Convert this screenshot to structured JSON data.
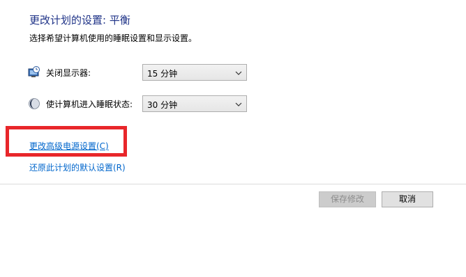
{
  "header": {
    "title": "更改计划的设置: 平衡",
    "subtitle": "选择希望计算机使用的睡眠设置和显示设置。"
  },
  "settings": {
    "display_off": {
      "label": "关闭显示器:",
      "value": "15 分钟",
      "icon": "monitor-clock-icon"
    },
    "sleep": {
      "label": "使计算机进入睡眠状态:",
      "value": "30 分钟",
      "icon": "moon-icon"
    }
  },
  "links": {
    "advanced": "更改高级电源设置(C)",
    "restore_defaults": "还原此计划的默认设置(R)"
  },
  "buttons": {
    "save": "保存修改",
    "cancel": "取消"
  },
  "colors": {
    "title": "#1e3287",
    "link": "#0066cc",
    "highlight": "#e8262a"
  }
}
